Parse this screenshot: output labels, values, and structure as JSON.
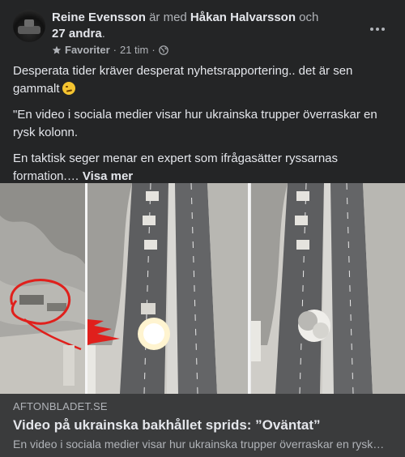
{
  "header": {
    "author": "Reine Evensson",
    "with_text": "är med",
    "tagged": "Håkan Halvarsson",
    "and_text": "och",
    "others": "27 andra",
    "period": ".",
    "audience_label": "Favoriter",
    "separator": "·",
    "time": "21 tim",
    "separator2": "·"
  },
  "post": {
    "line1": "Desperata tider kräver desperat nyhetsrapportering.. det är sen gammalt",
    "quote": "\"En video i sociala medier visar hur ukrainska trupper överraskar en rysk kolonn.",
    "line3": "En taktisk seger menar en expert som ifrågasätter ryssarnas formation.…",
    "see_more": "Visa mer"
  },
  "link_preview": {
    "domain": "AFTONBLADET.SE",
    "title": "Video på ukrainska bakhållet sprids: ”Oväntat”",
    "description": "En video i sociala medier visar hur ukrainska trupper överraskar en rysk kolonn..."
  },
  "icons": {
    "more": "ellipsis-icon",
    "audience": "star-icon",
    "privacy": "globe-icon",
    "emoji": "smirk-emoji-icon"
  },
  "colors": {
    "background": "#242526",
    "link_preview_bg": "#3a3b3c",
    "primary_text": "#e4e6eb",
    "secondary_text": "#b0b3b8",
    "annotation_red": "#e0201c"
  }
}
